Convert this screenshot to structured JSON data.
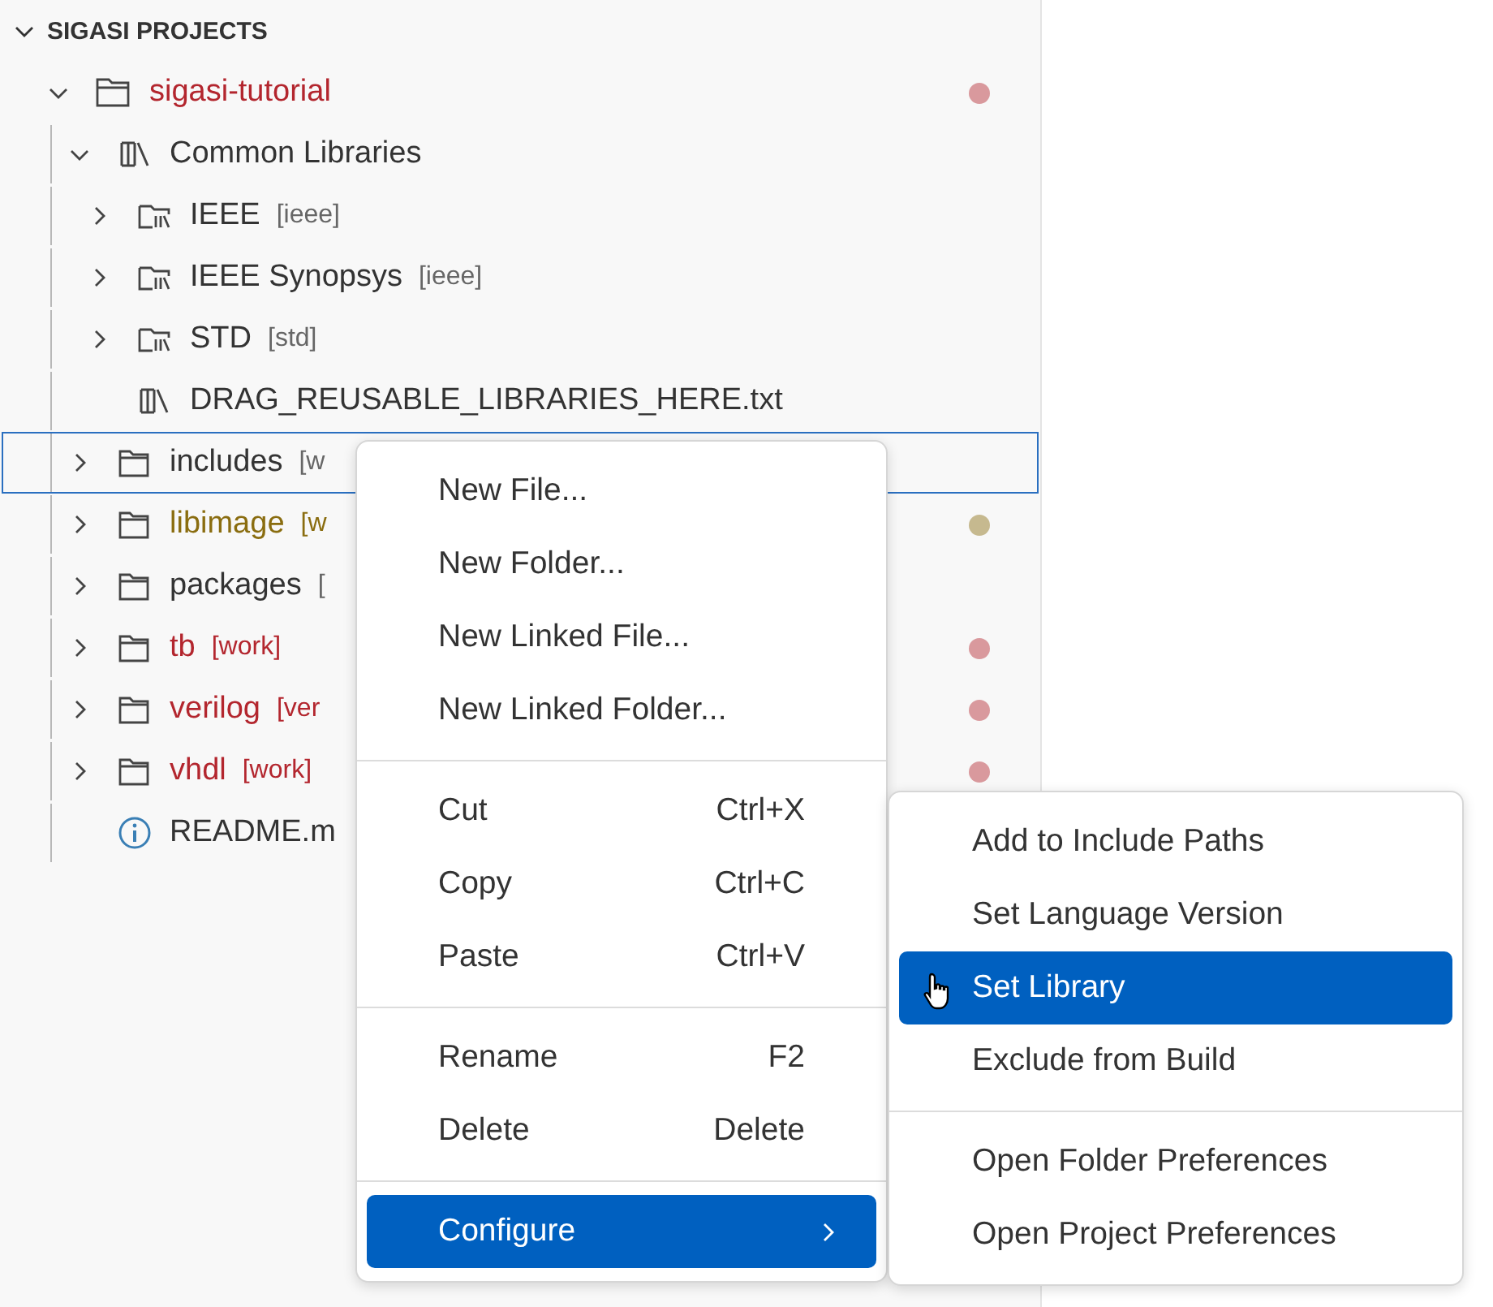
{
  "panel": {
    "title": "SIGASI PROJECTS",
    "expanded": true
  },
  "tree": [
    {
      "label": "sigasi-tutorial",
      "kind": "project",
      "expanded": true,
      "focused": false,
      "color": "#b3262e",
      "children": [
        {
          "label": "Common Libraries",
          "kind": "library",
          "expanded": true,
          "focused": false,
          "children": [
            {
              "label": "IEEE",
              "tag": "[ieee]",
              "kind": "lib-folder",
              "expanded": false,
              "focused": false
            },
            {
              "label": "IEEE Synopsys",
              "tag": "[ieee]",
              "kind": "lib-folder",
              "expanded": false,
              "focused": false
            },
            {
              "label": "STD",
              "tag": "[std]",
              "kind": "lib-folder",
              "expanded": false,
              "focused": false
            },
            {
              "label": "DRAG_REUSABLE_LIBRARIES_HERE.txt",
              "kind": "lib-file",
              "focused": false
            }
          ]
        },
        {
          "label": "includes",
          "tag": "[w",
          "kind": "folder",
          "expanded": false,
          "focused": true
        },
        {
          "label": "libimage",
          "tag": "[w",
          "kind": "folder",
          "expanded": false,
          "focused": false,
          "color": "#8a6d10"
        },
        {
          "label": "packages",
          "tag": "[",
          "kind": "folder",
          "expanded": false,
          "focused": false
        },
        {
          "label": "tb",
          "tag": "[work]",
          "kind": "folder",
          "expanded": false,
          "focused": false,
          "color": "#b3262e"
        },
        {
          "label": "verilog",
          "tag": "[ver",
          "kind": "folder",
          "expanded": false,
          "focused": false,
          "color": "#b3262e"
        },
        {
          "label": "vhdl",
          "tag": "[work]",
          "kind": "folder",
          "expanded": false,
          "focused": false,
          "color": "#b3262e"
        },
        {
          "label": "README.m",
          "kind": "info-file",
          "focused": false
        }
      ]
    }
  ],
  "context_menu": {
    "groups": [
      [
        {
          "label": "New File...",
          "selected": false
        },
        {
          "label": "New Folder...",
          "selected": false
        },
        {
          "label": "New Linked File...",
          "selected": false
        },
        {
          "label": "New Linked Folder...",
          "selected": false
        }
      ],
      [
        {
          "label": "Cut",
          "shortcut": "Ctrl+X",
          "selected": false
        },
        {
          "label": "Copy",
          "shortcut": "Ctrl+C",
          "selected": false
        },
        {
          "label": "Paste",
          "shortcut": "Ctrl+V",
          "selected": false
        }
      ],
      [
        {
          "label": "Rename",
          "shortcut": "F2",
          "selected": false
        },
        {
          "label": "Delete",
          "shortcut": "Delete",
          "selected": false
        }
      ],
      [
        {
          "label": "Configure",
          "selected": true,
          "submenu": true
        }
      ]
    ]
  },
  "submenu": {
    "groups": [
      [
        {
          "label": "Add to Include Paths",
          "selected": false
        },
        {
          "label": "Set Language Version",
          "selected": false
        },
        {
          "label": "Set Library",
          "selected": true
        },
        {
          "label": "Exclude from Build",
          "selected": false
        }
      ],
      [
        {
          "label": "Open Folder Preferences",
          "selected": false
        },
        {
          "label": "Open Project Preferences",
          "selected": false
        }
      ]
    ]
  }
}
